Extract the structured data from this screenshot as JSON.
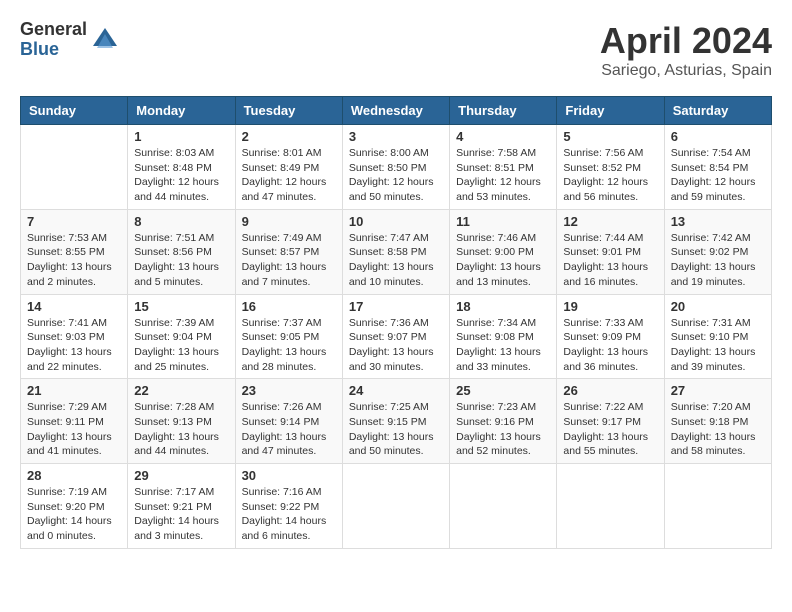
{
  "header": {
    "logo_general": "General",
    "logo_blue": "Blue",
    "month_title": "April 2024",
    "location": "Sariego, Asturias, Spain"
  },
  "days_of_week": [
    "Sunday",
    "Monday",
    "Tuesday",
    "Wednesday",
    "Thursday",
    "Friday",
    "Saturday"
  ],
  "weeks": [
    [
      {
        "day": "",
        "info": ""
      },
      {
        "day": "1",
        "info": "Sunrise: 8:03 AM\nSunset: 8:48 PM\nDaylight: 12 hours\nand 44 minutes."
      },
      {
        "day": "2",
        "info": "Sunrise: 8:01 AM\nSunset: 8:49 PM\nDaylight: 12 hours\nand 47 minutes."
      },
      {
        "day": "3",
        "info": "Sunrise: 8:00 AM\nSunset: 8:50 PM\nDaylight: 12 hours\nand 50 minutes."
      },
      {
        "day": "4",
        "info": "Sunrise: 7:58 AM\nSunset: 8:51 PM\nDaylight: 12 hours\nand 53 minutes."
      },
      {
        "day": "5",
        "info": "Sunrise: 7:56 AM\nSunset: 8:52 PM\nDaylight: 12 hours\nand 56 minutes."
      },
      {
        "day": "6",
        "info": "Sunrise: 7:54 AM\nSunset: 8:54 PM\nDaylight: 12 hours\nand 59 minutes."
      }
    ],
    [
      {
        "day": "7",
        "info": "Sunrise: 7:53 AM\nSunset: 8:55 PM\nDaylight: 13 hours\nand 2 minutes."
      },
      {
        "day": "8",
        "info": "Sunrise: 7:51 AM\nSunset: 8:56 PM\nDaylight: 13 hours\nand 5 minutes."
      },
      {
        "day": "9",
        "info": "Sunrise: 7:49 AM\nSunset: 8:57 PM\nDaylight: 13 hours\nand 7 minutes."
      },
      {
        "day": "10",
        "info": "Sunrise: 7:47 AM\nSunset: 8:58 PM\nDaylight: 13 hours\nand 10 minutes."
      },
      {
        "day": "11",
        "info": "Sunrise: 7:46 AM\nSunset: 9:00 PM\nDaylight: 13 hours\nand 13 minutes."
      },
      {
        "day": "12",
        "info": "Sunrise: 7:44 AM\nSunset: 9:01 PM\nDaylight: 13 hours\nand 16 minutes."
      },
      {
        "day": "13",
        "info": "Sunrise: 7:42 AM\nSunset: 9:02 PM\nDaylight: 13 hours\nand 19 minutes."
      }
    ],
    [
      {
        "day": "14",
        "info": "Sunrise: 7:41 AM\nSunset: 9:03 PM\nDaylight: 13 hours\nand 22 minutes."
      },
      {
        "day": "15",
        "info": "Sunrise: 7:39 AM\nSunset: 9:04 PM\nDaylight: 13 hours\nand 25 minutes."
      },
      {
        "day": "16",
        "info": "Sunrise: 7:37 AM\nSunset: 9:05 PM\nDaylight: 13 hours\nand 28 minutes."
      },
      {
        "day": "17",
        "info": "Sunrise: 7:36 AM\nSunset: 9:07 PM\nDaylight: 13 hours\nand 30 minutes."
      },
      {
        "day": "18",
        "info": "Sunrise: 7:34 AM\nSunset: 9:08 PM\nDaylight: 13 hours\nand 33 minutes."
      },
      {
        "day": "19",
        "info": "Sunrise: 7:33 AM\nSunset: 9:09 PM\nDaylight: 13 hours\nand 36 minutes."
      },
      {
        "day": "20",
        "info": "Sunrise: 7:31 AM\nSunset: 9:10 PM\nDaylight: 13 hours\nand 39 minutes."
      }
    ],
    [
      {
        "day": "21",
        "info": "Sunrise: 7:29 AM\nSunset: 9:11 PM\nDaylight: 13 hours\nand 41 minutes."
      },
      {
        "day": "22",
        "info": "Sunrise: 7:28 AM\nSunset: 9:13 PM\nDaylight: 13 hours\nand 44 minutes."
      },
      {
        "day": "23",
        "info": "Sunrise: 7:26 AM\nSunset: 9:14 PM\nDaylight: 13 hours\nand 47 minutes."
      },
      {
        "day": "24",
        "info": "Sunrise: 7:25 AM\nSunset: 9:15 PM\nDaylight: 13 hours\nand 50 minutes."
      },
      {
        "day": "25",
        "info": "Sunrise: 7:23 AM\nSunset: 9:16 PM\nDaylight: 13 hours\nand 52 minutes."
      },
      {
        "day": "26",
        "info": "Sunrise: 7:22 AM\nSunset: 9:17 PM\nDaylight: 13 hours\nand 55 minutes."
      },
      {
        "day": "27",
        "info": "Sunrise: 7:20 AM\nSunset: 9:18 PM\nDaylight: 13 hours\nand 58 minutes."
      }
    ],
    [
      {
        "day": "28",
        "info": "Sunrise: 7:19 AM\nSunset: 9:20 PM\nDaylight: 14 hours\nand 0 minutes."
      },
      {
        "day": "29",
        "info": "Sunrise: 7:17 AM\nSunset: 9:21 PM\nDaylight: 14 hours\nand 3 minutes."
      },
      {
        "day": "30",
        "info": "Sunrise: 7:16 AM\nSunset: 9:22 PM\nDaylight: 14 hours\nand 6 minutes."
      },
      {
        "day": "",
        "info": ""
      },
      {
        "day": "",
        "info": ""
      },
      {
        "day": "",
        "info": ""
      },
      {
        "day": "",
        "info": ""
      }
    ]
  ]
}
